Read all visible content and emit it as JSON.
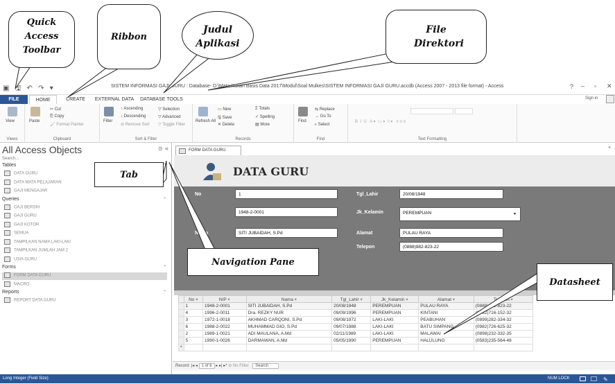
{
  "callouts": {
    "qat": "Quick Access Toolbar",
    "ribbon": "Ribbon",
    "judul": "Judul Aplikasi",
    "file": "File Direktori",
    "tab": "Tab",
    "navpane": "Navigation Pane",
    "datasheet": "Datasheet"
  },
  "window": {
    "title": "SISTEM INFORMASI GAJI GURU : Database- D:\\Mata Kuliah Basis Data 2017\\Modul\\Soal Mulkes\\SISTEM INFORMASI GAJI GURU.accdb (Access 2007 - 2013 file format) - Access",
    "help": "?",
    "signin": "Sign in"
  },
  "tabs": [
    "FILE",
    "HOME",
    "CREATE",
    "EXTERNAL DATA",
    "DATABASE TOOLS"
  ],
  "ribbon": {
    "views": {
      "label": "Views",
      "view": "View"
    },
    "clipboard": {
      "label": "Clipboard",
      "paste": "Paste",
      "cut": "Cut",
      "copy": "Copy",
      "format_painter": "Format Painter"
    },
    "sort": {
      "label": "Sort & Filter",
      "filter": "Filter",
      "asc": "Ascending",
      "desc": "Descending",
      "remove": "Remove Sort",
      "selection": "Selection",
      "advanced": "Advanced",
      "toggle": "Toggle Filter"
    },
    "records": {
      "label": "Records",
      "refresh": "Refresh All",
      "new": "New",
      "save": "Save",
      "delete": "Delete",
      "totals": "Totals",
      "spelling": "Spelling",
      "more": "More"
    },
    "find": {
      "label": "Find",
      "find": "Find",
      "replace": "Replace",
      "goto": "Go To",
      "select": "Select"
    },
    "text": {
      "label": "Text Formatting"
    }
  },
  "nav": {
    "title": "All Access Objects",
    "search": "Search...",
    "groups": [
      {
        "name": "Tables",
        "items": [
          "DATA GURU",
          "DATA MATA PELAJARAN",
          "GAJI MENGAJAR"
        ]
      },
      {
        "name": "Queries",
        "items": [
          "GAJI BERSIH",
          "GAJI GURU",
          "GAJI KOTOR",
          "SEMUA",
          "TAMPILKAN NAMA LAKI-LAKI",
          "TAMPILKAN JUMLAH JAM 2",
          "USIA GURU"
        ]
      },
      {
        "name": "Forms",
        "items": [
          "FORM DATA GURU",
          "MACRO"
        ]
      },
      {
        "name": "Reports",
        "items": [
          "REPORT DATA GURU"
        ]
      }
    ]
  },
  "form": {
    "tab": "FORM DATA GURU",
    "title": "DATA GURU",
    "fields": {
      "no_label": "No",
      "no": "1",
      "nip_label": "NIP",
      "nip": "1948-2-0001",
      "nama_label": "Nama",
      "nama": "SITI JUBAIDAH, S.Pd",
      "tgl_label": "Tgl_Lahir",
      "tgl": "20/08/1948",
      "jk_label": "Jk_Kelamin",
      "jk": "PEREMPUAN",
      "alamat_label": "Alamat",
      "alamat": "PULAU RAYA",
      "telp_label": "Telepon",
      "telp": "(0888)982-823-22"
    }
  },
  "datasheet": {
    "columns": [
      "No",
      "NIP",
      "Nama",
      "Tgl_Lahir",
      "Jk_Kelamin",
      "Alamat",
      "Telepon"
    ],
    "rows": [
      [
        "1",
        "1948-2-0001",
        "SITI JUBAIDAH, S.Pd",
        "20/08/1948",
        "PEREMPUAN",
        "PULAU RAYA",
        "(0888)982-823-22"
      ],
      [
        "4",
        "1996-2-0011",
        "Dra. REZKY NUR",
        "09/09/1996",
        "PEREMPUAN",
        "KINTANI",
        "(0982)716-152-32"
      ],
      [
        "3",
        "1972-1-0018",
        "AKHMAD CARQONI, S.Pd",
        "09/08/1972",
        "LAKI-LAKI",
        "PEABUHAN",
        "(0899)282-334-32"
      ],
      [
        "6",
        "1988-2-0022",
        "MUHAMMAD GIO, S.Pd",
        "09/07/1988",
        "LAKI-LAKI",
        "BATU SIMPANG",
        "(0982)726-625-32"
      ],
      [
        "2",
        "1989-1-0021",
        "ADI MAULANA, A.Md",
        "02/11/1989",
        "LAKI-LAKI",
        "MALAWAI",
        "(0898)232-332-35"
      ],
      [
        "5",
        "1990-1-0026",
        "DARMAWAN, A.Md",
        "05/05/1990",
        "PEREMPUAN",
        "HALULUNG",
        "(0583)235-564-48"
      ]
    ],
    "newrow": "*"
  },
  "recordnav": {
    "label": "Record:",
    "position": "1 of 6",
    "filter": "No Filter",
    "search": "Search"
  },
  "status": {
    "left": "Long Integer (Field Size)",
    "right": "NUM LOCK"
  },
  "colors": {
    "file_tab": "#2b5797",
    "status_bar": "#2b5797",
    "form_body": "#7a7a7a"
  }
}
